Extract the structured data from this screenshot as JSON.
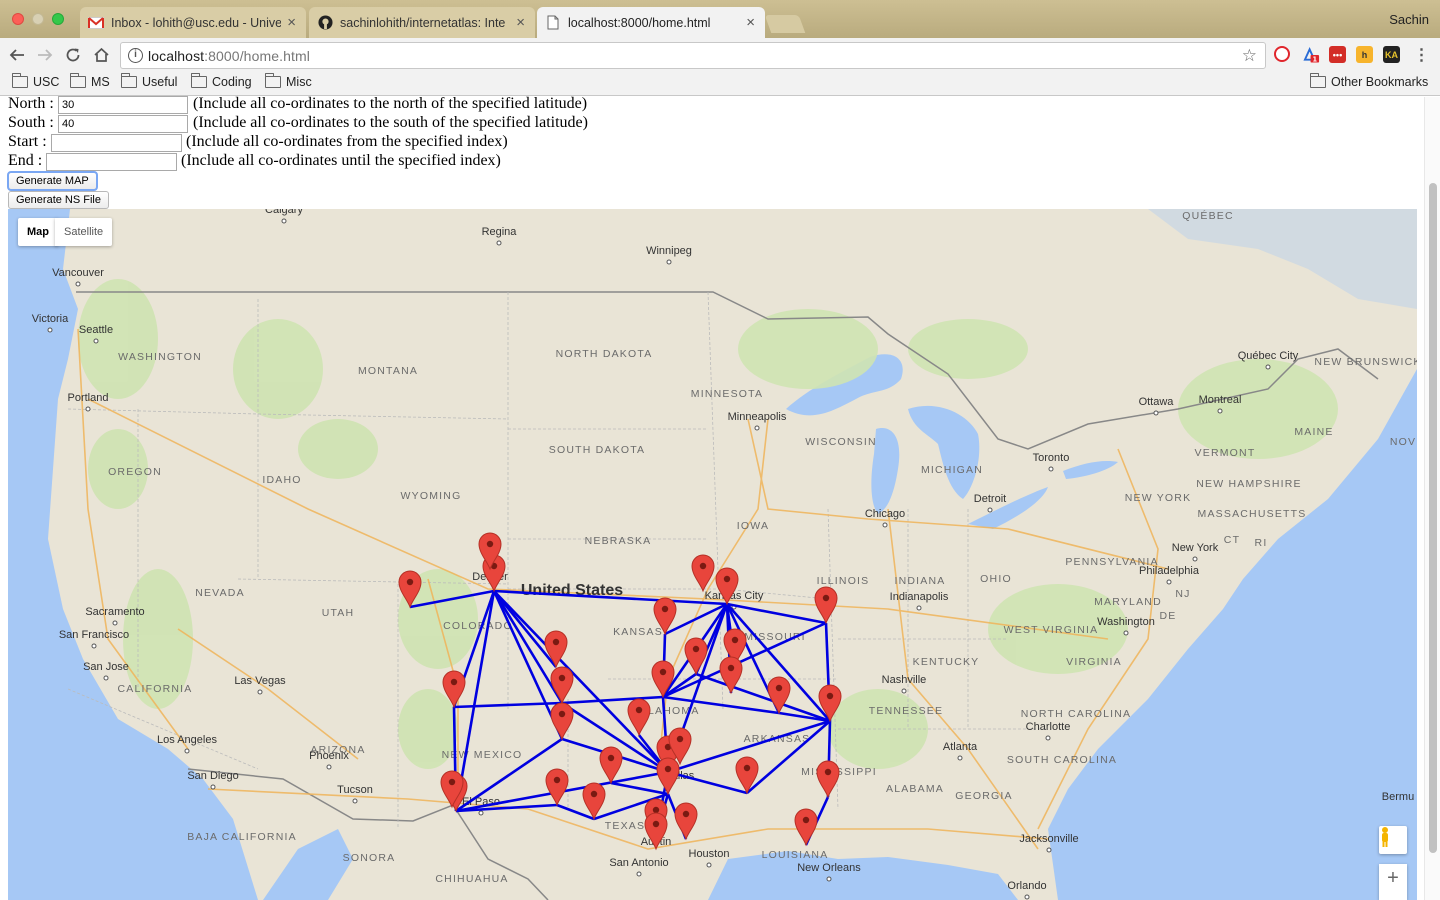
{
  "browser": {
    "tabs": [
      {
        "title": "Inbox - lohith@usc.edu - Unive",
        "icon": "gmail-icon"
      },
      {
        "title": "sachinlohith/internetatlas: Inte",
        "icon": "github-icon"
      },
      {
        "title": "localhost:8000/home.html",
        "icon": "page-icon",
        "active": true
      }
    ],
    "profile": "Sachin",
    "url_host": "localhost",
    "url_rest": ":8000/home.html",
    "bookmarks": [
      "USC",
      "MS",
      "Useful",
      "Coding",
      "Misc"
    ],
    "other_bookmarks": "Other Bookmarks",
    "extensions": [
      "opera-icon",
      "adblock-icon",
      "lastpass-icon",
      "honey-icon",
      "keepa-icon"
    ]
  },
  "form": {
    "north": {
      "label": "North :",
      "value": "30",
      "hint": "(Include all co-ordinates to the north of the specified latitude)"
    },
    "south": {
      "label": "South :",
      "value": "40",
      "hint": "(Include all co-ordinates to the south of the specified latitude)"
    },
    "start": {
      "label": "Start :",
      "value": "",
      "hint": "(Include all co-ordinates from the specified index)"
    },
    "end": {
      "label": "End :",
      "value": "",
      "hint": "(Include all co-ordinates until the specified index)"
    },
    "generate_map": "Generate MAP",
    "generate_ns": "Generate NS File"
  },
  "map": {
    "type_map": "Map",
    "type_satellite": "Satellite",
    "country_label": "United States",
    "colors": {
      "link": "#0000e0",
      "marker": "#e8453c",
      "water": "#a6c8f5",
      "land": "#e9e4d6"
    },
    "states": [
      "WASHINGTON",
      "OREGON",
      "IDAHO",
      "MONTANA",
      "WYOMING",
      "NORTH DAKOTA",
      "SOUTH DAKOTA",
      "NEBRASKA",
      "MINNESOTA",
      "WISCONSIN",
      "IOWA",
      "MICHIGAN",
      "NEVADA",
      "UTAH",
      "COLORADO",
      "KANSAS",
      "MISSOURI",
      "ILLINOIS",
      "INDIANA",
      "OHIO",
      "CALIFORNIA",
      "ARIZONA",
      "NEW MEXICO",
      "OKLAHOMA",
      "ARKANSAS",
      "TENNESSEE",
      "KENTUCKY",
      "WEST VIRGINIA",
      "VIRGINIA",
      "NORTH CAROLINA",
      "SOUTH CAROLINA",
      "GEORGIA",
      "ALABAMA",
      "MISSISSIPPI",
      "LOUISIANA",
      "TEXAS",
      "PENNSYLVANIA",
      "NEW YORK",
      "VERMONT",
      "NEW HAMPSHIRE",
      "MASSACHUSETTS",
      "MAINE",
      "MARYLAND",
      "DE",
      "NJ",
      "CT",
      "RI",
      "NEW BRUNSWICK",
      "QUÉBEC",
      "NOV",
      "BAJA CALIFORNIA",
      "SONORA",
      "CHIHUAHUA"
    ],
    "cities": [
      "Calgary",
      "Regina",
      "Winnipeg",
      "Vancouver",
      "Victoria",
      "Seattle",
      "Portland",
      "Minneapolis",
      "Sacramento",
      "San Francisco",
      "San Jose",
      "Las Vegas",
      "Los Angeles",
      "San Diego",
      "Phoenix",
      "Tucson",
      "El Paso",
      "Denver",
      "Kansas City",
      "Chicago",
      "Indianapolis",
      "Nashville",
      "Atlanta",
      "Charlotte",
      "Jacksonville",
      "Orlando",
      "New Orleans",
      "Houston",
      "Austin",
      "San Antonio",
      "Dallas",
      "Detroit",
      "Toronto",
      "Ottawa",
      "Montreal",
      "Québec City",
      "New York",
      "Philadelphia",
      "Washington",
      "Bermu"
    ]
  }
}
